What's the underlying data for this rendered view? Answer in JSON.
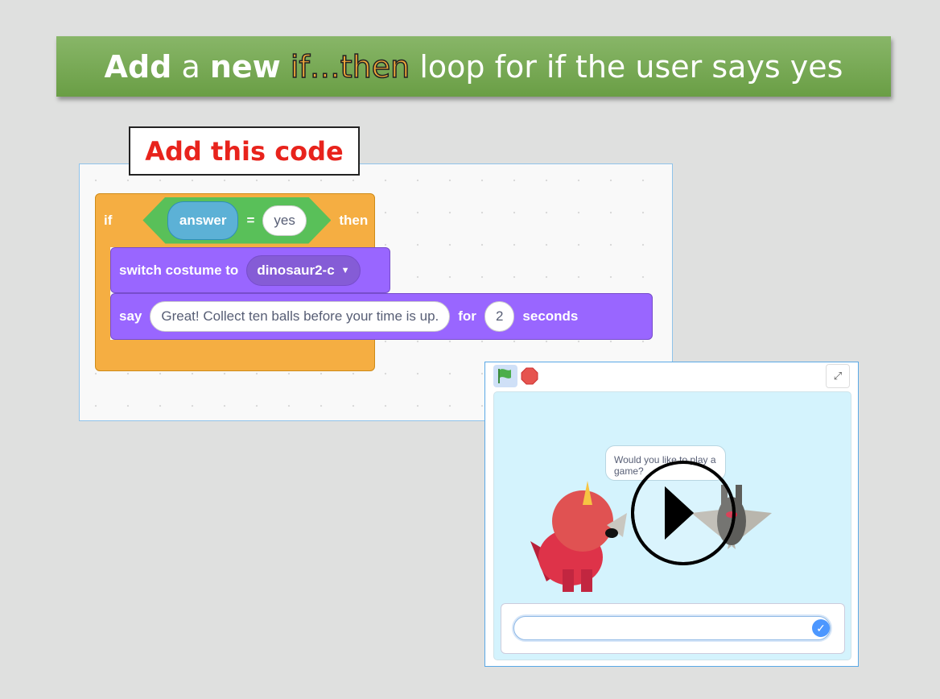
{
  "banner": {
    "part1": "Add",
    "part2": " a ",
    "part3": "new",
    "part4": " ",
    "highlight": "if…then",
    "part5": " loop for if the user says yes"
  },
  "callout": "Add this code",
  "code": {
    "if_label": "if",
    "variable": "answer",
    "operator": "=",
    "value": "yes",
    "then_label": "then",
    "switch_label": "switch costume to",
    "costume": "dinosaur2-c",
    "say_label": "say",
    "message": "Great! Collect ten balls before your time is up.",
    "for_label": "for",
    "seconds_value": "2",
    "seconds_label": "seconds"
  },
  "stage": {
    "speech": "Would you like to play a game?",
    "answer_value": "",
    "colors": {
      "stage_bg": "#d4f3fd",
      "flag": "#4cae4c",
      "stop": "#e6544f"
    }
  }
}
